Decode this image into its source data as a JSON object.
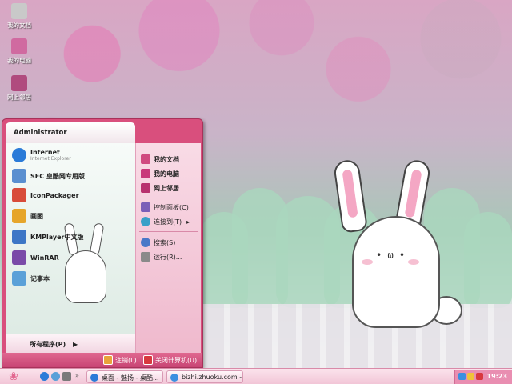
{
  "desktop": {
    "icons": [
      {
        "label": "我的文档",
        "color": "#c9c9c9"
      },
      {
        "label": "我的电脑",
        "color": "#d06aa0"
      },
      {
        "label": "网上邻居",
        "color": "#b04b7e"
      }
    ]
  },
  "start_menu": {
    "user": "Administrator",
    "programs": [
      {
        "label": "Internet",
        "sub": "Internet Explorer",
        "color": "#2b7bd8"
      },
      {
        "label": "SFC 皇酷网专用版",
        "sub": "",
        "color": "#5a8fd0"
      },
      {
        "label": "IconPackager",
        "sub": "",
        "color": "#d84c3a"
      },
      {
        "label": "画图",
        "sub": "",
        "color": "#e6a52a"
      },
      {
        "label": "KMPlayer中文版",
        "sub": "",
        "color": "#3d76c6"
      },
      {
        "label": "WinRAR",
        "sub": "",
        "color": "#7a4aa8"
      },
      {
        "label": "记事本",
        "sub": "",
        "color": "#5aa0d8"
      }
    ],
    "all_programs": "所有程序(P)",
    "right_items": [
      {
        "label": "我的文档",
        "color": "#d04a80",
        "bold": true
      },
      {
        "label": "我的电脑",
        "color": "#c9387a",
        "bold": true
      },
      {
        "label": "网上邻居",
        "color": "#b8306e",
        "bold": true
      },
      {
        "label": "控制面板(C)",
        "color": "#7a5fb8",
        "bold": false
      },
      {
        "label": "连接到(T)",
        "color": "#3aa0c8",
        "bold": false
      },
      {
        "label": "搜索(S)",
        "color": "#4a78c8",
        "bold": false
      },
      {
        "label": "运行(R)...",
        "color": "#8a8a8a",
        "bold": false
      }
    ],
    "logoff": "注销(L)",
    "shutdown": "关闭计算机(U)"
  },
  "taskbar": {
    "tasks": [
      {
        "label": "桌面 - 魅扬 - 桌酷...",
        "color": "#2b7bd8"
      },
      {
        "label": "bizhi.zhuoku.com - ...",
        "color": "#3c8fe0"
      }
    ],
    "clock": "19:23"
  }
}
